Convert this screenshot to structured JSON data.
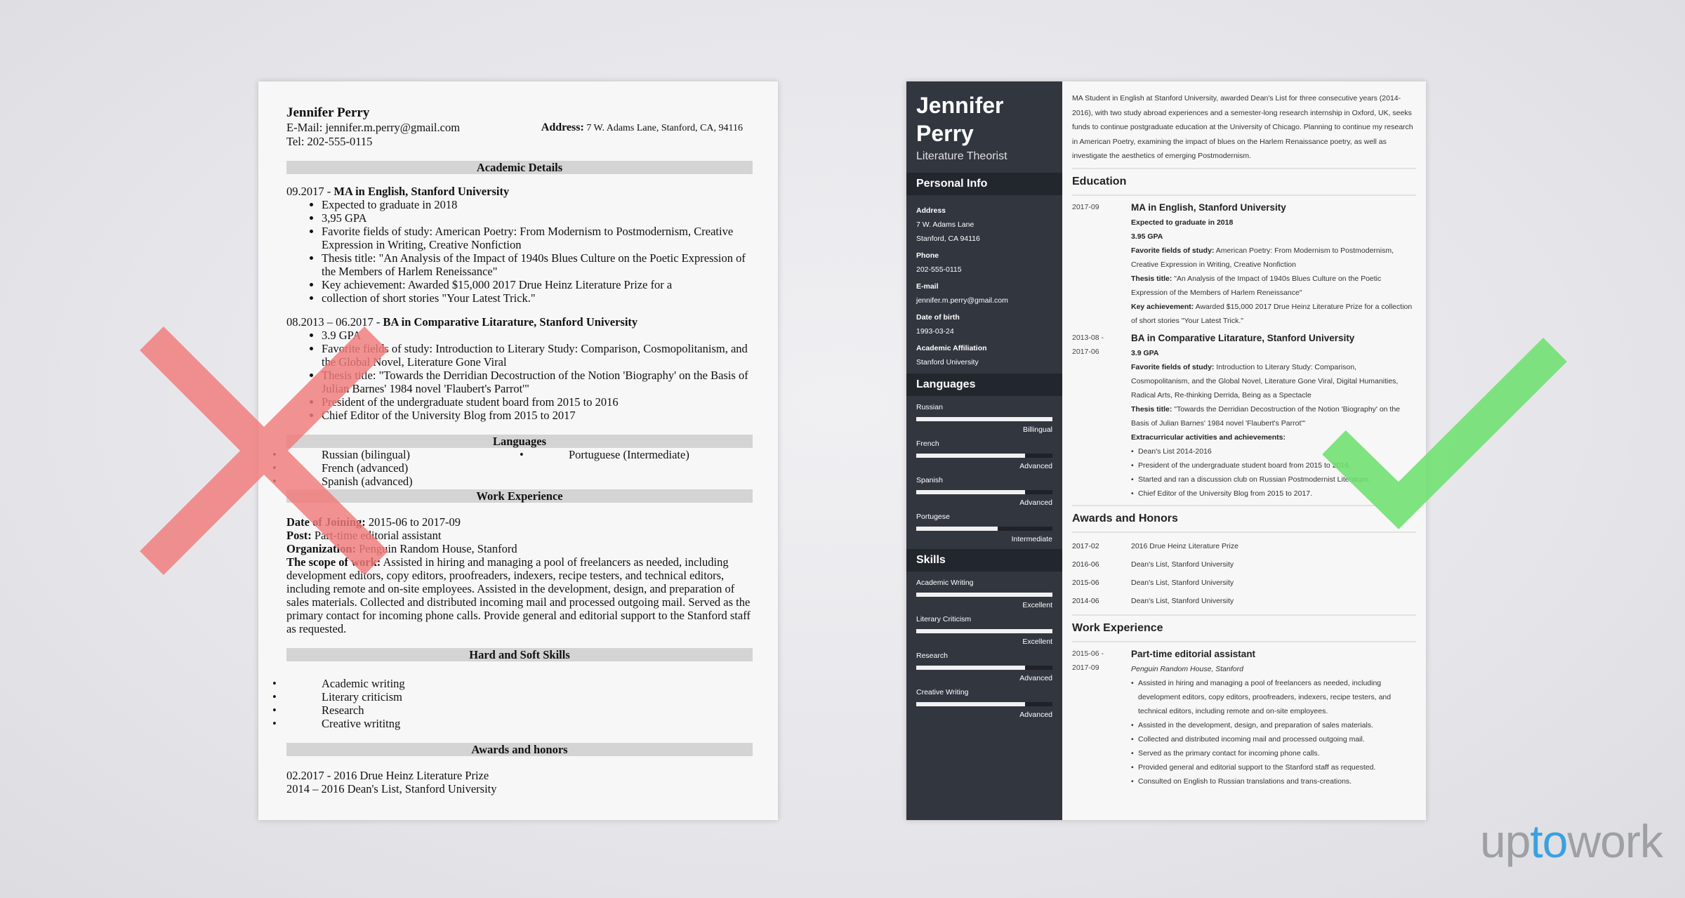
{
  "bad_resume": {
    "name": "Jennifer Perry",
    "email_label": "E-Mail:",
    "email": "jennifer.m.perry@gmail.com",
    "address_label": "Address:",
    "address": "7 W. Adams Lane, Stanford, CA, 94116",
    "tel_label": "Tel:",
    "tel": "202-555-0115",
    "sections": {
      "academic": "Academic Details",
      "languages": "Languages",
      "work": "Work Experience",
      "skills": "Hard and Soft Skills",
      "awards": "Awards and honors"
    },
    "education": [
      {
        "date": "09.2017 - ",
        "title": "MA in English, Stanford University",
        "bullets": [
          "Expected to graduate in 2018",
          "3,95 GPA",
          "Favorite fields of study: American Poetry: From Modernism to Postmodernism, Creative Expression in Writing, Creative Nonfiction",
          "Thesis title: \"An Analysis of the Impact of 1940s Blues Culture on the Poetic Expression of the Members of Harlem Reneissance\"",
          "Key achievement: Awarded $15,000 2017 Drue Heinz Literature Prize for a",
          "collection of short stories \"Your Latest Trick.\""
        ]
      },
      {
        "date": "08.2013 – 06.2017 - ",
        "title": "BA in Comparative Litarature, Stanford University",
        "bullets": [
          "3.9 GPA",
          "Favorite fields of study: Introduction to Literary Study: Comparison, Cosmopolitanism, and the Global Novel, Literature Gone Viral",
          "Thesis title: \"Towards the Derridian Decostruction of the Notion 'Biography' on the Basis of Julian Barnes' 1984 novel 'Flaubert's Parrot'\"",
          "President of the undergraduate student board from 2015 to 2016",
          "Chief Editor of the University Blog from 2015 to 2017"
        ]
      }
    ],
    "languages_col1": [
      "Russian (bilingual)",
      "French (advanced)",
      "Spanish (advanced)"
    ],
    "languages_col2": [
      "Portuguese (Intermediate)"
    ],
    "work": {
      "date_label": "Date of Joining:",
      "date": " 2015-06 to 2017-09",
      "post_label": "Post:",
      "post": " Part-time editorial assistant",
      "org_label": "Organization:",
      "org": " Penguin Random House, Stanford",
      "scope_label": "The scope of work:",
      "scope": " Assisted in hiring and managing a pool of freelancers as needed, including development editors, copy editors, proofreaders, indexers, recipe testers, and technical editors, including remote and on-site employees. Assisted in the development, design, and preparation of sales materials. Collected and distributed incoming mail and processed outgoing mail. Served as the primary contact for incoming phone calls. Provide general and editorial support to the Stanford staff as requested."
    },
    "skills": [
      "Academic writing",
      "Literary criticism",
      "Research",
      "Creative writitng"
    ],
    "awards": [
      "02.2017 - 2016 Drue Heinz Literature Prize",
      "2014 – 2016 Dean's List, Stanford University"
    ]
  },
  "good_resume": {
    "name_first": "Jennifer",
    "name_last": "Perry",
    "role": "Literature Theorist",
    "sidebar": {
      "personal_info_title": "Personal Info",
      "fields": [
        {
          "label": "Address",
          "lines": [
            "7 W. Adams Lane",
            "Stanford, CA 94116"
          ]
        },
        {
          "label": "Phone",
          "lines": [
            "202-555-0115"
          ]
        },
        {
          "label": "E-mail",
          "lines": [
            "jennifer.m.perry@gmail.com"
          ]
        },
        {
          "label": "Date of birth",
          "lines": [
            "1993-03-24"
          ]
        },
        {
          "label": "Academic Affiliation",
          "lines": [
            "Stanford University"
          ]
        }
      ],
      "languages_title": "Languages",
      "languages": [
        {
          "name": "Russian",
          "level": "Billingual",
          "fill": 1.0
        },
        {
          "name": "French",
          "level": "Advanced",
          "fill": 0.8
        },
        {
          "name": "Spanish",
          "level": "Advanced",
          "fill": 0.8
        },
        {
          "name": "Portugese",
          "level": "Intermediate",
          "fill": 0.6
        }
      ],
      "skills_title": "Skills",
      "skills": [
        {
          "name": "Academic Writing",
          "level": "Excellent",
          "fill": 1.0
        },
        {
          "name": "Literary Criticism",
          "level": "Excellent",
          "fill": 1.0
        },
        {
          "name": "Research",
          "level": "Advanced",
          "fill": 0.8
        },
        {
          "name": "Creative Writing",
          "level": "Advanced",
          "fill": 0.8
        }
      ]
    },
    "summary": "MA Student in English at Stanford University, awarded Dean's List for three consecutive years (2014-2016), with two study abroad experiences and a semester-long research internship in Oxford, UK, seeks funds to continue postgraduate education at the University of Chicago. Planning to continue my research in American Poetry, examining the impact of blues on the Harlem Renaissance poetry, as well as investigate the aesthetics of emerging Postmodernism.",
    "education_title": "Education",
    "education": [
      {
        "date": "2017-09",
        "title": "MA in English, Stanford University",
        "bold_lines": [
          "Expected to graduate in 2018",
          "3.95 GPA"
        ],
        "fields": [
          {
            "label": "Favorite fields of study:",
            "text": " American Poetry: From Modernism to Postmodernism, Creative Expression in Writing, Creative Nonfiction"
          },
          {
            "label": "Thesis title:",
            "text": " \"An Analysis of the Impact of 1940s Blues Culture on the Poetic Expression of the Members of Harlem Reneissance\""
          },
          {
            "label": "Key achievement:",
            "text": " Awarded $15,000 2017 Drue Heinz Literature Prize for a collection of short stories \"Your Latest Trick.\""
          }
        ]
      },
      {
        "date": "2013-08 - 2017-06",
        "title": "BA in Comparative Litarature, Stanford University",
        "bold_lines": [
          "3.9 GPA"
        ],
        "fields": [
          {
            "label": "Favorite fields of study:",
            "text": " Introduction to Literary Study: Comparison, Cosmopolitanism, and the Global Novel, Literature Gone Viral, Digital Humanities, Radical Arts, Re-thinking Derrida, Being as a Spectacle"
          },
          {
            "label": "Thesis title:",
            "text": " \"Towards the Derridian Decostruction of the Notion 'Biography' on the Basis of Julian Barnes' 1984 novel 'Flaubert's Parrot'\""
          }
        ],
        "extra_label": "Extracurricular activities and achievements:",
        "bullets": [
          "Dean's List 2014-2016",
          "President of the undergraduate student board from 2015 to 2016.",
          "Started and ran a discussion club on Russian Postmodernist Literature.",
          "Chief Editor of the University Blog from 2015 to 2017."
        ]
      }
    ],
    "awards_title": "Awards and Honors",
    "awards": [
      {
        "date": "2017-02",
        "text": "2016 Drue Heinz Literature Prize"
      },
      {
        "date": "2016-06",
        "text": "Dean's List, Stanford University"
      },
      {
        "date": "2015-06",
        "text": "Dean's List, Stanford University"
      },
      {
        "date": "2014-06",
        "text": "Dean's List, Stanford University"
      }
    ],
    "work_title": "Work Experience",
    "work": {
      "date": "2015-06 - 2017-09",
      "title": "Part-time editorial assistant",
      "org": "Penguin Random House, Stanford",
      "bullets": [
        "Assisted in hiring and managing a pool of freelancers as needed, including development editors, copy editors, proofreaders, indexers, recipe testers, and technical editors, including remote and on-site employees.",
        "Assisted in the development, design, and preparation of sales materials.",
        "Collected and distributed incoming mail and processed outgoing mail.",
        "Served as the primary contact for incoming phone calls.",
        "Provided general and editorial support to the Stanford staff as requested.",
        "Consulted on English to Russian translations and trans-creations."
      ]
    }
  },
  "marks": {
    "bad_color": "#f27b7b",
    "good_color": "#6ee070"
  },
  "logo": {
    "part1": "up",
    "part2": "to",
    "part3": "work",
    "accent": "#3aa0e0"
  }
}
